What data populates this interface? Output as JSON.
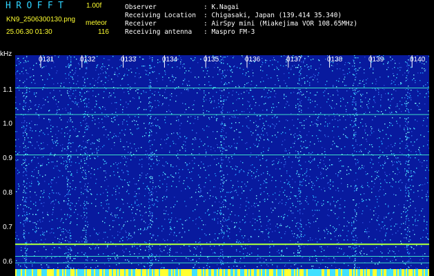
{
  "header": {
    "app_title": "HROFFT",
    "version": "1.00f",
    "filename": "KN9_2506300130.png",
    "datetime": "25.06.30 01:30",
    "meteor_label": "meteor",
    "meteor_count": "116"
  },
  "info": {
    "rows": [
      {
        "label": "Observer",
        "value": ": K.Nagai"
      },
      {
        "label": "Receiving Location",
        "value": ": Chigasaki, Japan (139.414 35.340)"
      },
      {
        "label": "Receiver",
        "value": ": AirSpy mini (Miakejima VOR 108.65MHz)"
      },
      {
        "label": "Receiving antenna",
        "value": ": Maspro FM-3"
      }
    ]
  },
  "axes": {
    "y_unit": "kHz",
    "y_ticks": [
      "1.1",
      "1.0",
      "0.9",
      "0.8",
      "0.7",
      "0.6"
    ],
    "x_ticks": [
      "0131",
      "0132",
      "0133",
      "0134",
      "0135",
      "0136",
      "0137",
      "0138",
      "0139",
      "0140"
    ]
  },
  "spectrogram": {
    "background": "#081a9e",
    "noise_colors": [
      "#2b4bd8",
      "#3a7cf0",
      "#20a0ff",
      "#40e0ff",
      "#7cf7ff"
    ],
    "carrier_color": "#44ffd0",
    "band_color": "#ffff30",
    "carrier_freqs_khz": [
      1.105,
      1.028,
      0.911,
      0.652,
      0.617,
      0.598
    ],
    "strong_carrier_khz": 0.652
  }
}
